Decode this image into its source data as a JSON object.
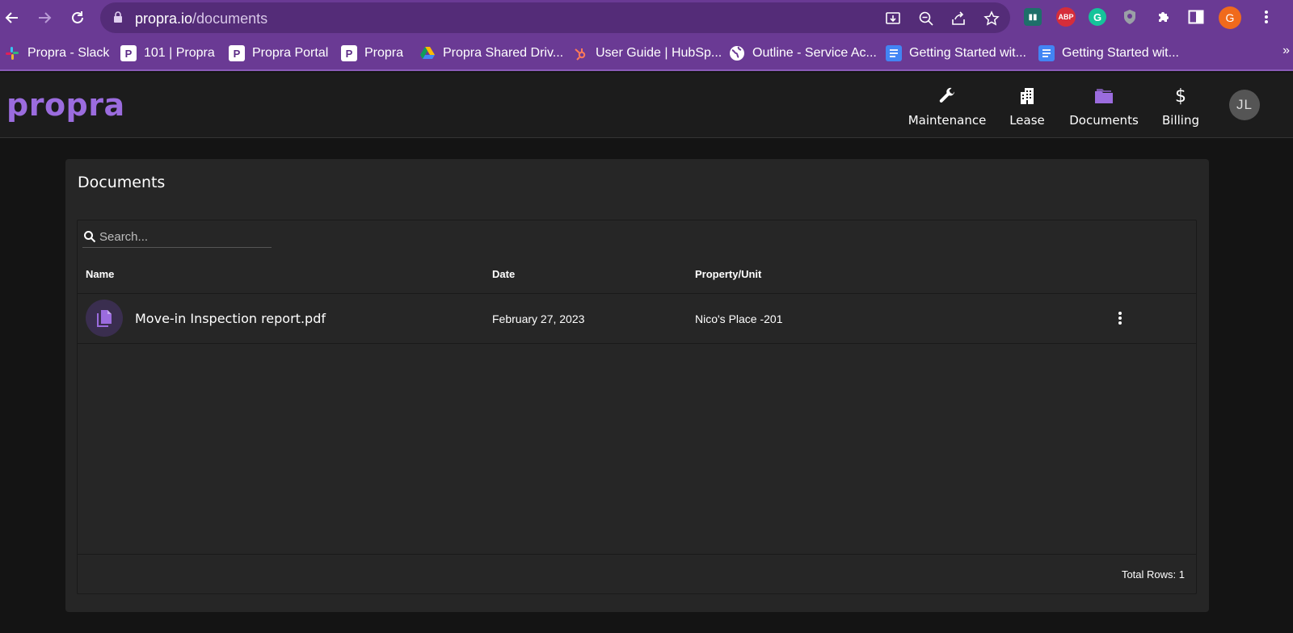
{
  "browser": {
    "url_host": "propra.io",
    "url_path": "/documents",
    "profile_initial": "G",
    "extensions": [
      {
        "name": "extension-sider-icon",
        "text": "",
        "color": "#1e6f6a"
      },
      {
        "name": "extension-abp-icon",
        "text": "ABP",
        "color": "#d62d3a"
      },
      {
        "name": "extension-grammarly-icon",
        "text": "G",
        "color": "#15c39a"
      },
      {
        "name": "extension-shield-icon",
        "text": "",
        "color": "#9aa0a6"
      }
    ]
  },
  "bookmarks": [
    {
      "label": "Propra - Slack",
      "icon": "slack-icon"
    },
    {
      "label": "101 | Propra",
      "icon": "propra-p-icon"
    },
    {
      "label": "Propra Portal",
      "icon": "propra-p-icon"
    },
    {
      "label": "Propra",
      "icon": "propra-p-icon"
    },
    {
      "label": "Propra Shared Driv...",
      "icon": "google-drive-icon"
    },
    {
      "label": "User Guide | HubSp...",
      "icon": "hubspot-icon"
    },
    {
      "label": "Outline - Service Ac...",
      "icon": "globe-icon"
    },
    {
      "label": "Getting Started wit...",
      "icon": "google-docs-icon"
    },
    {
      "label": "Getting Started wit...",
      "icon": "google-docs-icon"
    }
  ],
  "bookmarks_more": "»",
  "app": {
    "logo": "propra",
    "nav": [
      {
        "label": "Maintenance",
        "icon": "wrench-icon"
      },
      {
        "label": "Lease",
        "icon": "building-icon"
      },
      {
        "label": "Documents",
        "icon": "folder-icon",
        "active": true
      },
      {
        "label": "Billing",
        "icon": "dollar-icon"
      }
    ],
    "avatar_initials": "JL",
    "accent_color": "#9b6cde"
  },
  "documents": {
    "title": "Documents",
    "search_placeholder": "Search...",
    "columns": [
      "Name",
      "Date",
      "Property/Unit"
    ],
    "rows": [
      {
        "name": "Move-in Inspection report.pdf",
        "date": "February 27, 2023",
        "property": "Nico's Place -201"
      }
    ],
    "total_rows": "Total Rows: 1"
  }
}
